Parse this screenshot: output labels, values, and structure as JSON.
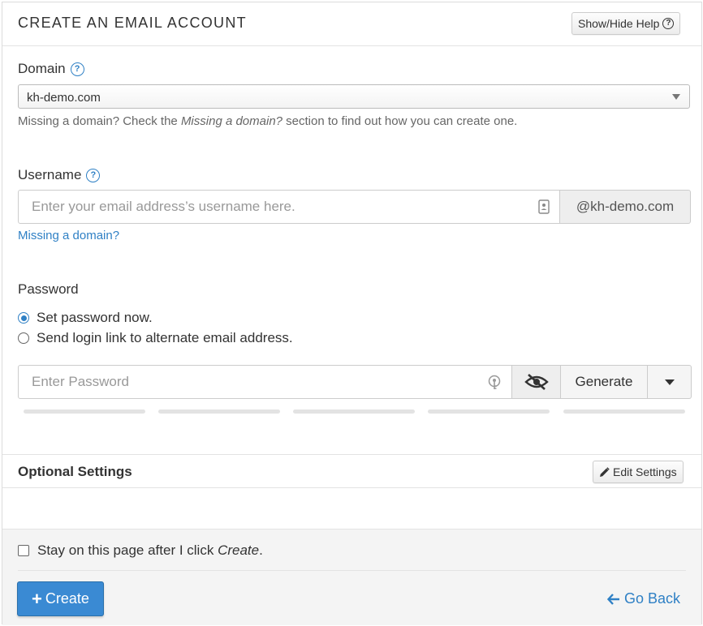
{
  "header": {
    "title": "CREATE AN EMAIL ACCOUNT",
    "help_button": "Show/Hide Help"
  },
  "domain": {
    "label": "Domain",
    "selected": "kh-demo.com",
    "hint_prefix": "Missing a domain? Check the ",
    "hint_em": "Missing a domain?",
    "hint_suffix": " section to find out how you can create one."
  },
  "username": {
    "label": "Username",
    "placeholder": "Enter your email address’s username here.",
    "suffix": "@kh-demo.com",
    "missing_link": "Missing a domain?"
  },
  "password": {
    "label": "Password",
    "options": [
      {
        "label": "Set password now.",
        "selected": true
      },
      {
        "label": "Send login link to alternate email address.",
        "selected": false
      }
    ],
    "placeholder": "Enter Password",
    "generate_label": "Generate"
  },
  "optional": {
    "title": "Optional Settings",
    "edit_button": "Edit Settings"
  },
  "footer": {
    "stay_prefix": "Stay on this page after I click ",
    "stay_em": "Create",
    "stay_suffix": ".",
    "create_label": "Create",
    "back_label": "Go Back"
  },
  "colors": {
    "accent": "#2f80c5",
    "primary_button": "#3a8ad3"
  }
}
